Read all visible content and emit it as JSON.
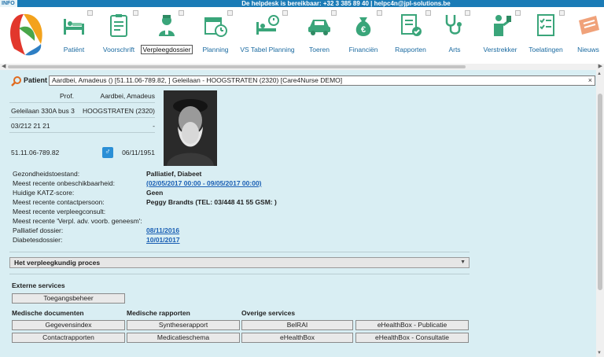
{
  "info": {
    "label": "INFO",
    "helpdesk": "De helpdesk is bereikbaar: +32 3 385 89 40 | helpc4n@jpl-solutions.be"
  },
  "nav": {
    "items": [
      {
        "label": "Patiënt",
        "icon": "patient-bed-icon"
      },
      {
        "label": "Voorschrift",
        "icon": "clipboard-icon"
      },
      {
        "label": "Verpleegdossier",
        "icon": "nurse-icon",
        "active": true
      },
      {
        "label": "Planning",
        "icon": "calendar-clock-icon"
      },
      {
        "label": "VS Tabel Planning",
        "icon": "bed-clock-icon"
      },
      {
        "label": "Toeren",
        "icon": "car-icon"
      },
      {
        "label": "Financiën",
        "icon": "money-bag-icon"
      },
      {
        "label": "Rapporten",
        "icon": "report-icon"
      },
      {
        "label": "Arts",
        "icon": "stethoscope-icon"
      },
      {
        "label": "Verstrekker",
        "icon": "caregiver-icon"
      },
      {
        "label": "Toelatingen",
        "icon": "checklist-icon"
      },
      {
        "label": "Nieuws",
        "icon": "newspaper-icon"
      }
    ]
  },
  "patient_search": {
    "label": "Patient",
    "value": "Aardbei, Amadeus () [51.11.06-789.82, ] Geleilaan - HOOGSTRATEN (2320) [Care4Nurse DEMO]",
    "clear": "×"
  },
  "card": {
    "title": "Prof.",
    "name": "Aardbei, Amadeus",
    "street": "Geleilaan 330A bus 3",
    "city": "HOOGSTRATEN (2320)",
    "phone": "03/212 21 21",
    "phone_extra": "-",
    "ssn": "51.11.06-789.82",
    "gender_symbol": "♂",
    "birthdate": "06/11/1951"
  },
  "facts": [
    {
      "key": "Gezondheidstoestand:",
      "value": "Palliatief, Diabeet",
      "link": false
    },
    {
      "key": "Meest recente onbeschikbaarheid:",
      "value": "(02/05/2017 00:00 - 09/05/2017 00:00)",
      "link": true
    },
    {
      "key": "Huidige KATZ-score:",
      "value": "Geen",
      "link": false
    },
    {
      "key": "Meest recente contactpersoon:",
      "value": "Peggy Brandts (TEL: 03/448 41 55 GSM: )",
      "link": false
    },
    {
      "key": "Meest recente verpleegconsult:",
      "value": "",
      "link": false
    },
    {
      "key": "Meest recente 'Verpl. adv. voorb. geneesm':",
      "value": "",
      "link": false
    },
    {
      "key": "Palliatief dossier:",
      "value": "08/11/2016",
      "link": true
    },
    {
      "key": "Diabetesdossier:",
      "value": "10/01/2017",
      "link": true
    }
  ],
  "process": {
    "label": "Het verpleegkundig proces",
    "arrow": "▼"
  },
  "services": {
    "external_title": "Externe services",
    "access_button": "Toegangsbeheer",
    "medical_docs_title": "Medische documenten",
    "medical_reports_title": "Medische rapporten",
    "other_title": "Overige services",
    "buttons_row1": [
      "Gegevensindex",
      "Syntheserapport",
      "BelRAI",
      "eHealthBox - Publicatie"
    ],
    "buttons_row2": [
      "Contactrapporten",
      "Medicatieschema",
      "eHealthBox",
      "eHealthBox - Consultatie"
    ]
  },
  "colors": {
    "brand_blue": "#1a7bb6",
    "icon_green": "#3aa57a",
    "background": "#d9eef3",
    "link": "#1a5fb4"
  }
}
